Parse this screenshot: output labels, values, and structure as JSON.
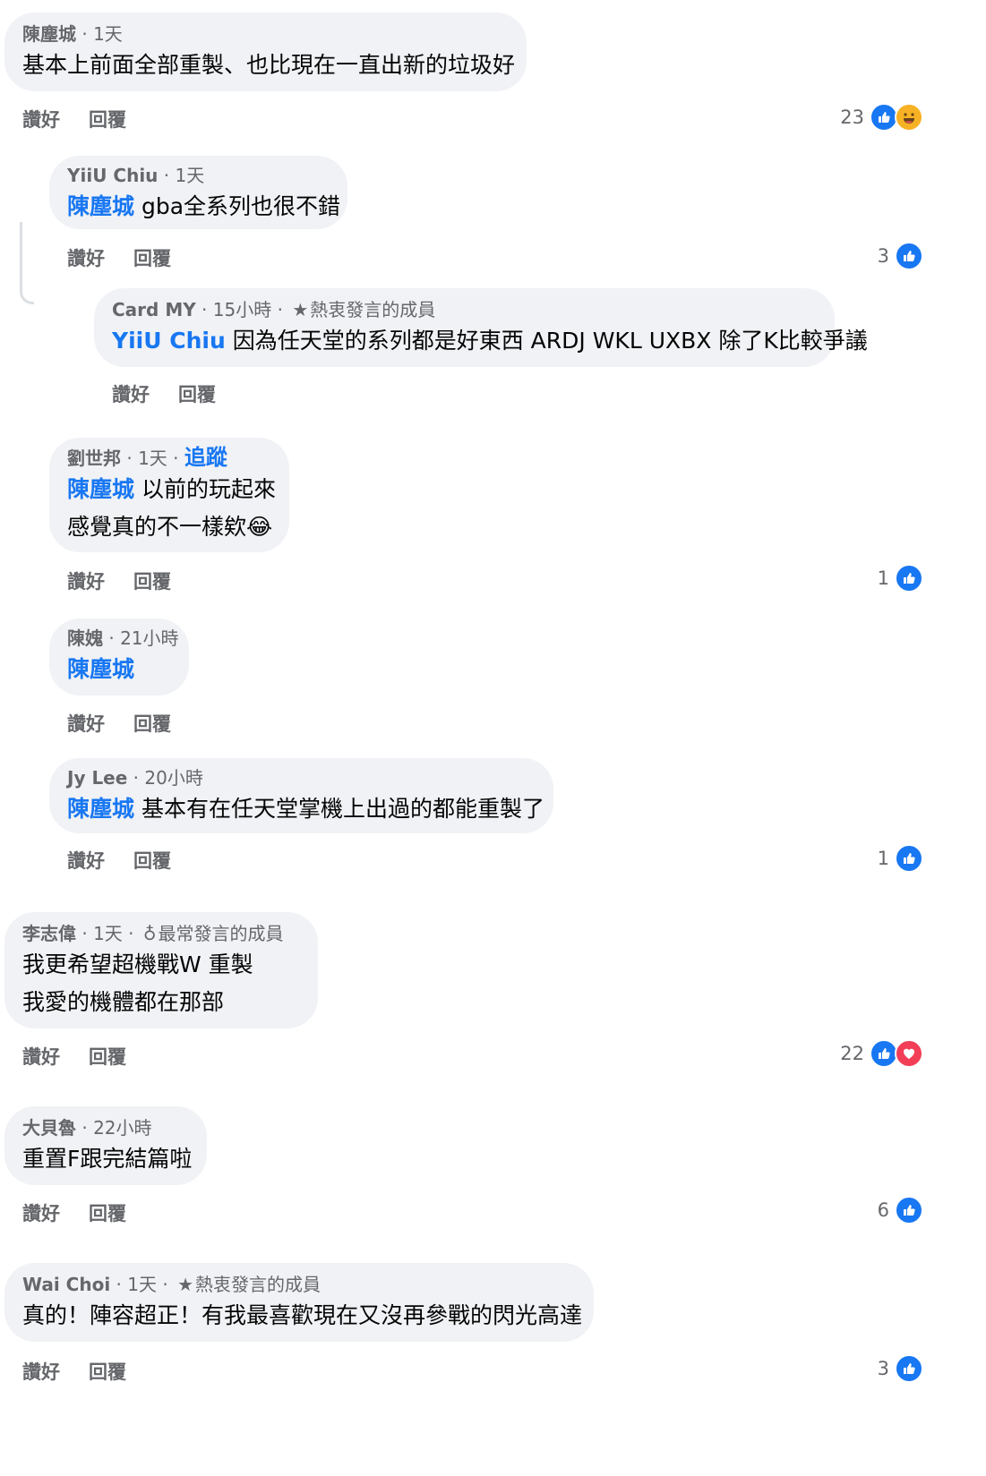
{
  "actions": {
    "like": "讚好",
    "reply": "回覆"
  },
  "colors": {
    "accent": "#1877f2",
    "bubble": "#f0f2f5",
    "meta": "#65676b"
  },
  "comments": [
    {
      "author": "陳塵城",
      "time": "1天",
      "text": "基本上前面全部重製、也比現在一直出新的垃圾好",
      "count": "23",
      "reactions": [
        "like-icon",
        "haha-icon"
      ]
    },
    {
      "author": "YiiU Chiu",
      "time": "1天",
      "tag": "陳塵城",
      "text": " gba全系列也很不錯",
      "count": "3",
      "reactions": [
        "like-icon"
      ]
    },
    {
      "author": "Card MY",
      "time": "15小時",
      "badge": "熱衷發言的成員",
      "badge_icon": "star-icon",
      "tag": "YiiU Chiu",
      "text": " 因為任天堂的系列都是好東西 ARDJ WKL UXBX 除了K比較爭議"
    },
    {
      "author": "劉世邦",
      "time": "1天",
      "follow": "追蹤",
      "tag": "陳塵城",
      "text": " 以前的玩起來",
      "line2": "感覺真的不一樣欸😂",
      "count": "1",
      "reactions": [
        "like-icon"
      ]
    },
    {
      "author": "陳媿",
      "time": "21小時",
      "tag": "陳塵城"
    },
    {
      "author": "Jy Lee",
      "time": "20小時",
      "tag": "陳塵城",
      "text": " 基本有在任天堂掌機上出過的都能重製了",
      "count": "1",
      "reactions": [
        "like-icon"
      ]
    },
    {
      "author": "李志偉",
      "time": "1天",
      "badge": "最常發言的成員",
      "badge_icon": "award-icon",
      "text": "我更希望超機戰W 重製",
      "line2": "我愛的機體都在那部",
      "count": "22",
      "reactions": [
        "like-icon",
        "love-icon"
      ]
    },
    {
      "author": "大貝魯",
      "time": "22小時",
      "text": "重置F跟完結篇啦",
      "count": "6",
      "reactions": [
        "like-icon"
      ]
    },
    {
      "author": "Wai Choi",
      "time": "1天",
      "badge": "熱衷發言的成員",
      "badge_icon": "star-icon",
      "text": "真的！陣容超正！有我最喜歡現在又沒再參戰的閃光高達",
      "count": "3",
      "reactions": [
        "like-icon"
      ]
    }
  ]
}
